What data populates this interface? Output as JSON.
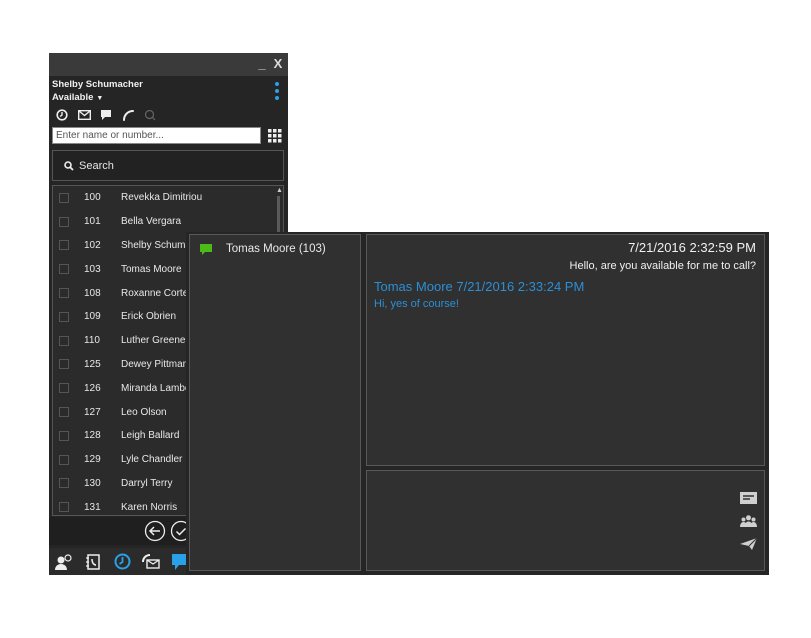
{
  "main_window": {
    "title_controls": {
      "minimize": "_",
      "close": "X"
    },
    "user": {
      "name": "Shelby Schumacher",
      "status": "Available"
    },
    "quick_icons": [
      "history-icon",
      "voicemail-icon",
      "chat-icon",
      "phone-icon",
      "search-icon"
    ],
    "dial_input": {
      "value": "",
      "placeholder": "Enter name or number..."
    },
    "search_button": {
      "label": "Search"
    },
    "contacts": [
      {
        "ext": "100",
        "name": "Revekka Dimitriou"
      },
      {
        "ext": "101",
        "name": "Bella Vergara"
      },
      {
        "ext": "102",
        "name": "Shelby Schumacher"
      },
      {
        "ext": "103",
        "name": "Tomas Moore"
      },
      {
        "ext": "108",
        "name": "Roxanne Cortez"
      },
      {
        "ext": "109",
        "name": "Erick Obrien"
      },
      {
        "ext": "110",
        "name": "Luther Greene"
      },
      {
        "ext": "125",
        "name": "Dewey Pittman"
      },
      {
        "ext": "126",
        "name": "Miranda Lambert"
      },
      {
        "ext": "127",
        "name": "Leo Olson"
      },
      {
        "ext": "128",
        "name": "Leigh Ballard"
      },
      {
        "ext": "129",
        "name": "Lyle Chandler"
      },
      {
        "ext": "130",
        "name": "Darryl Terry"
      },
      {
        "ext": "131",
        "name": "Karen Norris"
      }
    ],
    "bottom_bar": [
      "presence-icon",
      "contacts-book-icon",
      "history-icon",
      "voicemail-icon",
      "chat-icon"
    ],
    "colors": {
      "accent": "#2aa0e6",
      "chat_green": "#4cbb17"
    }
  },
  "chat_window": {
    "conversations": [
      {
        "label": "Tomas Moore (103)"
      }
    ],
    "messages": [
      {
        "header": "7/21/2016 2:32:59 PM",
        "text": "Hello, are you available for me to call?",
        "side": "right"
      },
      {
        "header": "Tomas Moore 7/21/2016 2:33:24 PM",
        "text": "Hi, yes of course!",
        "side": "left"
      }
    ],
    "composer": {
      "value": "",
      "placeholder": ""
    },
    "composer_icons": [
      "message-template-icon",
      "participants-icon",
      "send-icon"
    ],
    "colors": {
      "remote_message": "#2b8fd6"
    }
  }
}
